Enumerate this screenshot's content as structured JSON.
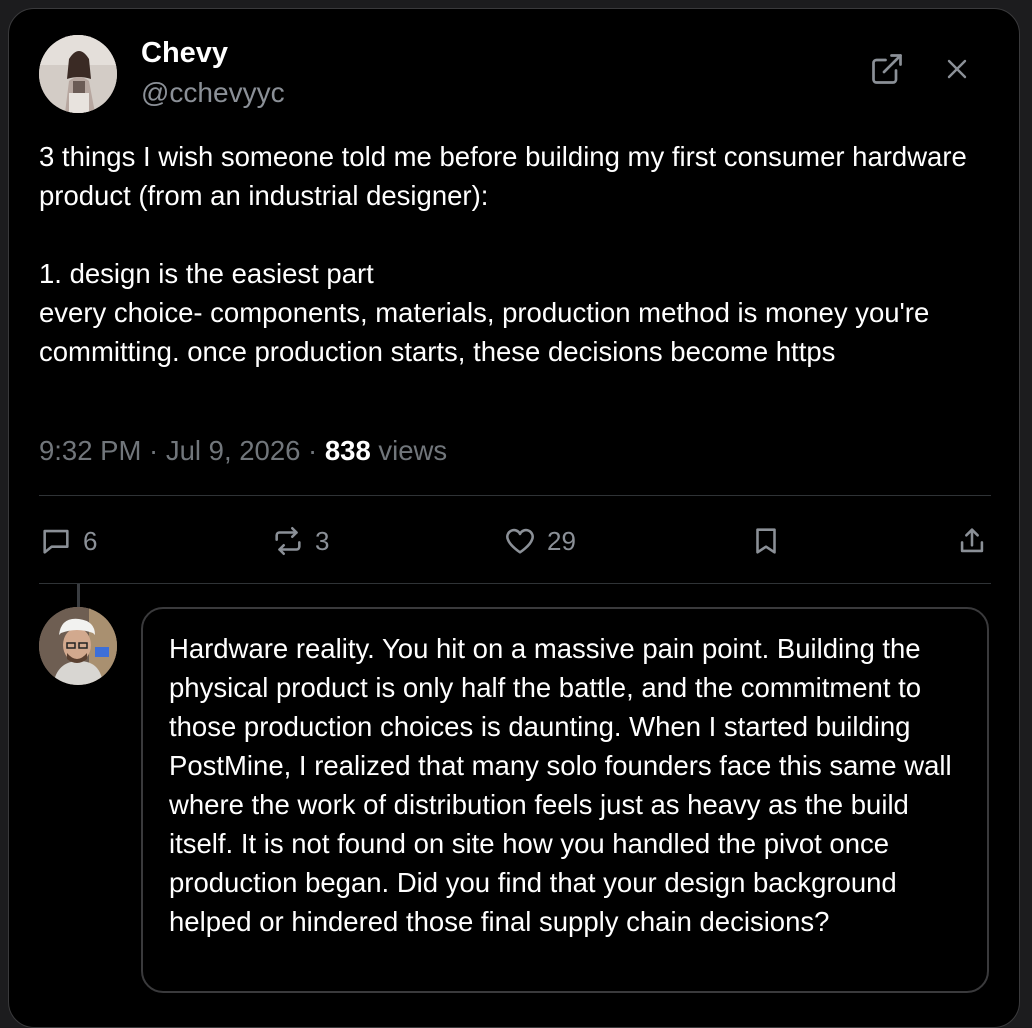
{
  "author": {
    "name": "Chevy",
    "handle": "@cchevyyc"
  },
  "tweet": {
    "text": "3 things I wish someone told me before building my first consumer hardware product (from an industrial designer):\n\n1. design is the easiest part\nevery choice- components, materials, production method is money you're committing. once production starts, these decisions become https",
    "time": "9:32 PM",
    "date": "Jul 9, 2026",
    "separator": " · ",
    "views_count": "838",
    "views_label": " views"
  },
  "actions": {
    "replies": "6",
    "retweets": "3",
    "likes": "29"
  },
  "reply": {
    "text": "Hardware reality. You hit on a massive pain point. Building the physical product is only half the battle, and the commitment to those production choices is daunting. When I started building PostMine, I realized that many solo founders face this same wall where the work of distribution feels just as heavy as the build itself. It is not found on site how you handled the pivot once production began. Did you find that your design background helped or hindered those final supply chain decisions?"
  },
  "icons": {
    "open": "external-link-icon",
    "close": "close-icon",
    "reply": "reply-icon",
    "retweet": "retweet-icon",
    "like": "heart-icon",
    "bookmark": "bookmark-icon",
    "share": "share-icon"
  },
  "colors": {
    "background": "#000000",
    "text": "#ffffff",
    "muted": "#71767b",
    "border": "#3a3a3c"
  }
}
